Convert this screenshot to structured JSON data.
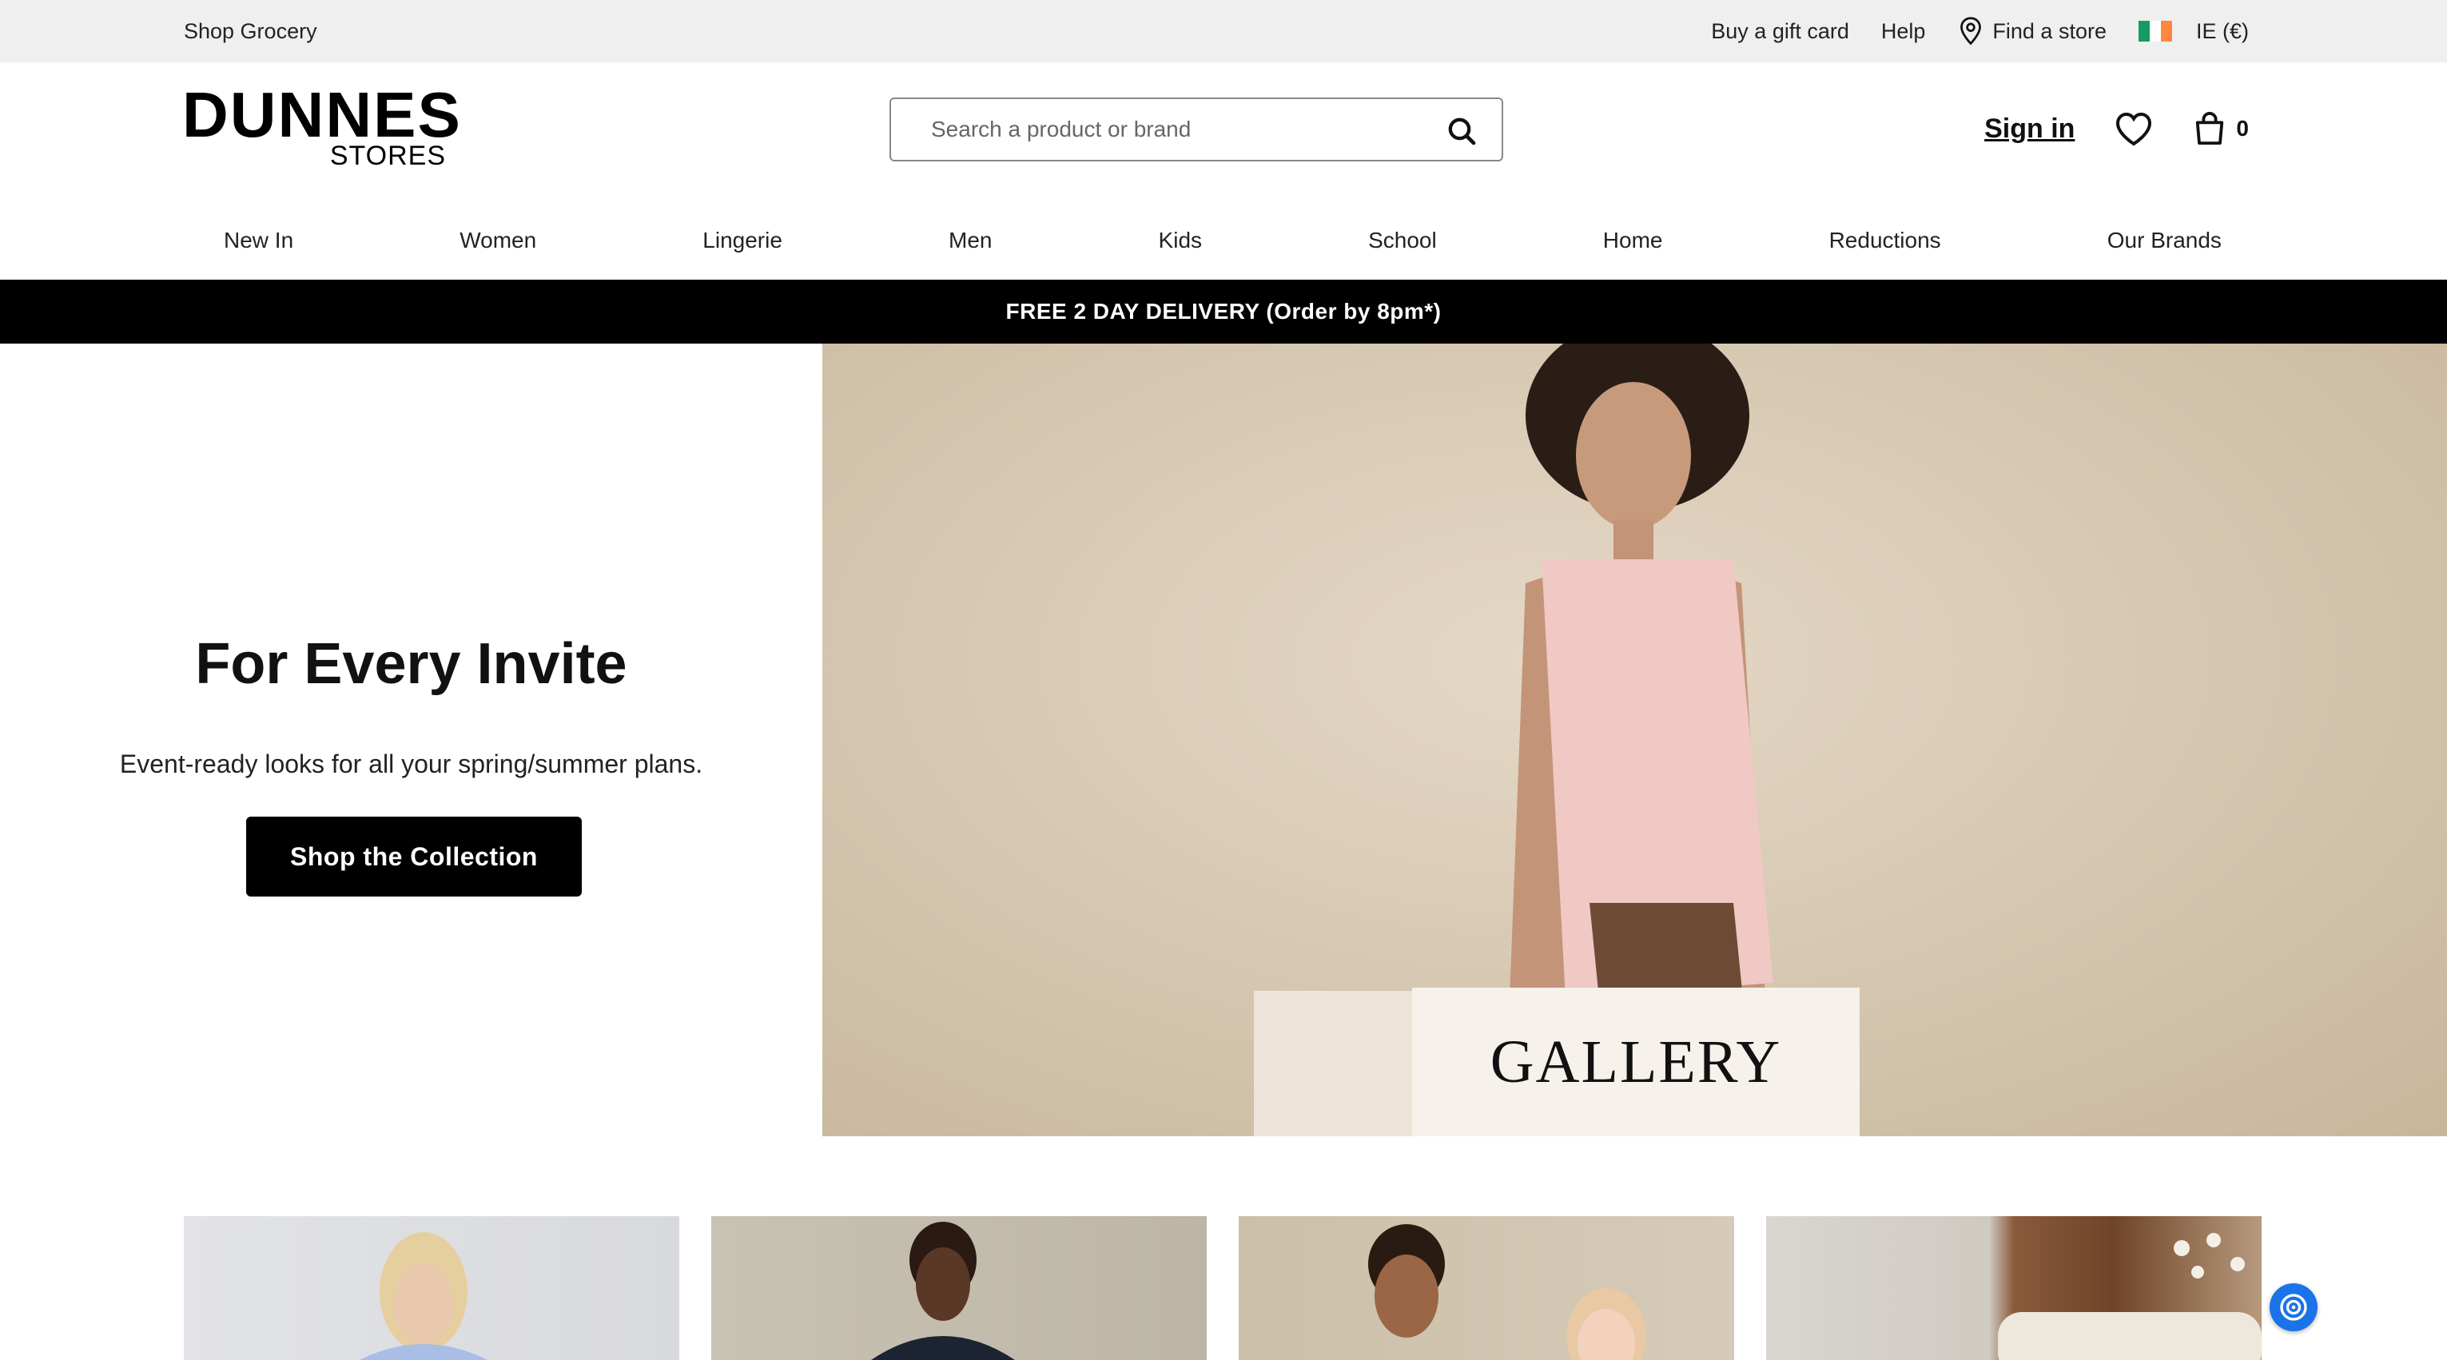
{
  "utility_bar": {
    "shop_grocery": "Shop Grocery",
    "gift_card": "Buy a gift card",
    "help": "Help",
    "find_store": "Find a store",
    "region": "IE (€)"
  },
  "header": {
    "logo_main": "DUNNES",
    "logo_sub": "STORES",
    "search_placeholder": "Search a product or brand",
    "sign_in": "Sign in",
    "cart_count": "0"
  },
  "nav": {
    "items": [
      "New In",
      "Women",
      "Lingerie",
      "Men",
      "Kids",
      "School",
      "Home",
      "Reductions",
      "Our Brands"
    ]
  },
  "promo": {
    "text": "FREE 2 DAY DELIVERY (Order by 8pm*)"
  },
  "hero": {
    "title": "For Every Invite",
    "subtitle": "Event-ready looks for all your spring/summer plans.",
    "cta": "Shop the Collection",
    "image_label": "GALLERY"
  },
  "colors": {
    "accent": "#000000",
    "utility_bg": "#efefef",
    "flag_green": "#169b62",
    "flag_white": "#ffffff",
    "flag_orange": "#ff883e",
    "assist_blue": "#1a73e8"
  },
  "icons": {
    "search": "search-icon",
    "location": "location-pin-icon",
    "wishlist": "heart-icon",
    "cart": "shopping-bag-icon"
  }
}
